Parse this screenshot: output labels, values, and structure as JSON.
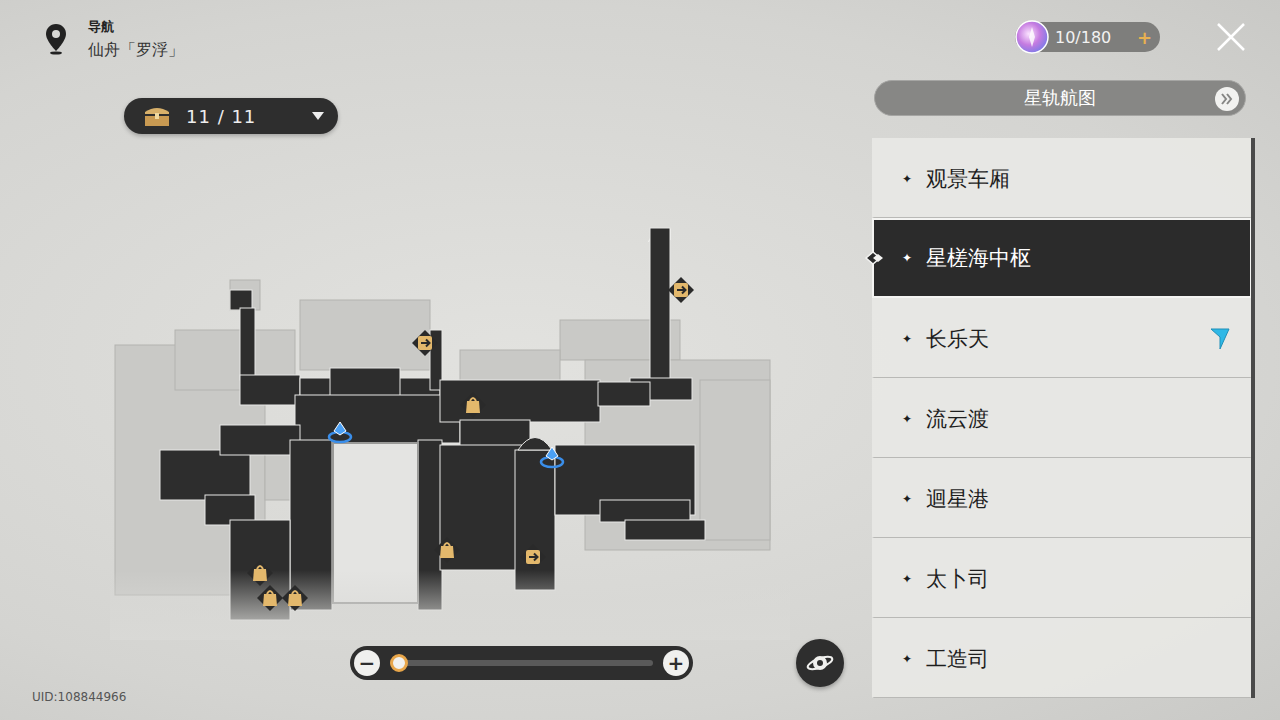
{
  "header": {
    "label": "导航",
    "location": "仙舟「罗浮」"
  },
  "chests": {
    "count": "11 / 11"
  },
  "currency": {
    "amount": "10/180",
    "add": "+"
  },
  "starRailMap": {
    "label": "星轨航图"
  },
  "areas": [
    {
      "name": "观景车厢",
      "icon": "✦",
      "selected": false,
      "current": false
    },
    {
      "name": "星槎海中枢",
      "icon": "✦",
      "selected": true,
      "current": false
    },
    {
      "name": "长乐天",
      "icon": "✦",
      "selected": false,
      "current": true
    },
    {
      "name": "流云渡",
      "icon": "✦",
      "selected": false,
      "current": false
    },
    {
      "name": "迴星港",
      "icon": "✦",
      "selected": false,
      "current": false
    },
    {
      "name": "太卜司",
      "icon": "✦",
      "selected": false,
      "current": false
    },
    {
      "name": "工造司",
      "icon": "✦",
      "selected": false,
      "current": false
    }
  ],
  "pins": [
    {
      "kind": "shop"
    },
    {
      "kind": "shop"
    },
    {
      "kind": "shop"
    },
    {
      "kind": "shop"
    },
    {
      "kind": "shop"
    },
    {
      "kind": "exit"
    },
    {
      "kind": "exit"
    },
    {
      "kind": "exit"
    },
    {
      "kind": "teleport"
    },
    {
      "kind": "teleport"
    }
  ],
  "zoom": {
    "minus": "−",
    "plus": "+",
    "level": 0
  },
  "uid": "UID:108844966"
}
